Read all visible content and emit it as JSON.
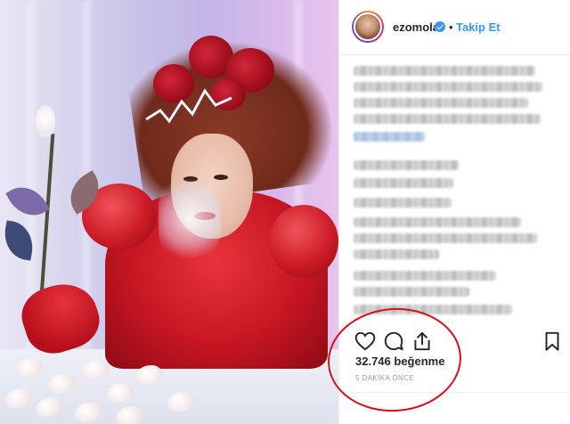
{
  "post": {
    "username": "ezomola",
    "verified": true,
    "separator": "•",
    "follow_label": "Takip Et",
    "likes_text": "32.746 beğenme",
    "timestamp": "5 DAKİKA ÖNCE",
    "caption": "",
    "comments": []
  },
  "icons": {
    "like": "heart-icon",
    "comment": "comment-icon",
    "share": "share-icon",
    "save": "bookmark-icon",
    "verified": "verified-badge-icon"
  },
  "colors": {
    "link_blue": "#3897f0",
    "text": "#262626",
    "muted": "#999999",
    "highlight_circle": "#d8101b"
  }
}
